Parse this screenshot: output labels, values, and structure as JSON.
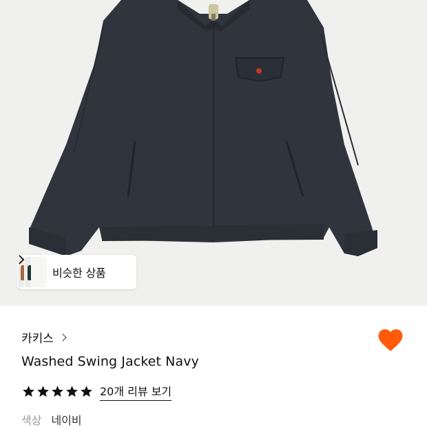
{
  "similar": {
    "label": "비슷한 상품",
    "swatch_colors": [
      "#a06a3f",
      "#1f3a36",
      "#ffffff"
    ]
  },
  "product": {
    "brand": "카키스",
    "name": "Washed Swing Jacket Navy",
    "rating_stars": 5,
    "review_link": "20개 리뷰 보기",
    "option_label": "색상",
    "option_value": "네이비",
    "liked": true
  },
  "colors": {
    "jacket": "#2f343d",
    "accent_heart": "#ff5a0a",
    "button": "#c0392b"
  },
  "icons": [
    "chevron-right-icon",
    "heart-icon",
    "star-icon"
  ]
}
